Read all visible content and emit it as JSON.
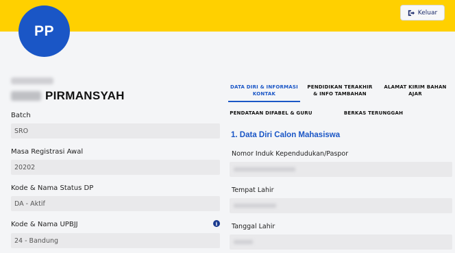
{
  "header": {
    "logout_label": "Keluar",
    "accent_color": "#ffd000"
  },
  "avatar": {
    "initials": "PP",
    "color": "#1a56c6"
  },
  "profile": {
    "name_visible": "PIRMANSYAH"
  },
  "left_fields": [
    {
      "label": "Batch",
      "value": "SRO"
    },
    {
      "label": "Masa Registrasi Awal",
      "value": "20202"
    },
    {
      "label": "Kode & Nama Status DP",
      "value": "DA - Aktif"
    },
    {
      "label": "Kode & Nama UPBJJ",
      "value": "24 - Bandung"
    }
  ],
  "tabs": [
    {
      "label": "DATA DIRI & INFORMASI KONTAK",
      "active": true
    },
    {
      "label": "PENDIDIKAN TERAKHIR & INFO TAMBAHAN",
      "active": false
    },
    {
      "label": "ALAMAT KIRIM BAHAN AJAR",
      "active": false
    },
    {
      "label": "PENDATAAN DIFABEL & GURU",
      "active": false
    },
    {
      "label": "BERKAS TERUNGGAH",
      "active": false
    }
  ],
  "section": {
    "title": "1. Data Diri Calon Mahasiswa",
    "fields": [
      {
        "label": "Nomor Induk Kependudukan/Paspor"
      },
      {
        "label": "Tempat Lahir"
      },
      {
        "label": "Tanggal Lahir"
      }
    ]
  }
}
